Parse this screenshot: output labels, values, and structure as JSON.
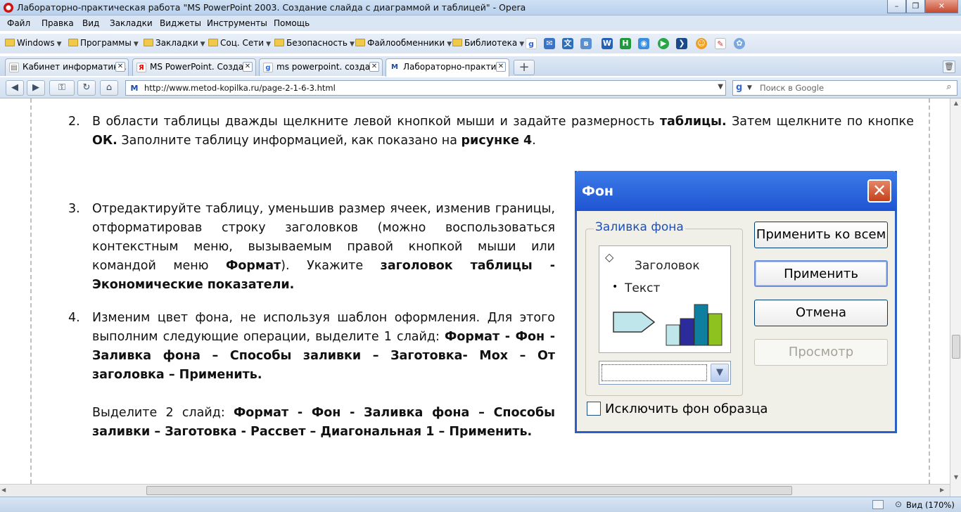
{
  "window": {
    "title": "Лабораторно-практическая работа \"MS PowerPoint 2003. Создание слайда с диаграммой и таблицей\" - Opera",
    "controls": [
      "–",
      "❐",
      "✕"
    ]
  },
  "menu": [
    "Файл",
    "Правка",
    "Вид",
    "Закладки",
    "Виджеты",
    "Инструменты",
    "Помощь"
  ],
  "bookmarks": {
    "folders": [
      "Windows",
      "Программы",
      "Закладки",
      "Соц. Сети",
      "Безопасность",
      "Файлообменники",
      "Библиотека"
    ],
    "icons": [
      "google-icon",
      "mail-icon",
      "translate-icon",
      "vk-icon",
      "word-icon",
      "h-icon",
      "web-icon",
      "play-icon",
      "arrow-icon",
      "smile-icon",
      "note-icon",
      "flower-icon"
    ]
  },
  "tabs": [
    {
      "label": "Кабинет информатик...",
      "favicon": "doc-icon"
    },
    {
      "label": "MS PowerPoint. Созда...",
      "favicon": "yandex-icon"
    },
    {
      "label": "ms powerpoint. созда...",
      "favicon": "google-icon"
    },
    {
      "label": "Лабораторно-практи...",
      "favicon": "M"
    }
  ],
  "nav": {
    "url": "http://www.metod-kopilka.ru/page-2-1-6-3.html",
    "search_placeholder": "Поиск в Google",
    "favicon": "M"
  },
  "content": {
    "item2": {
      "num": "2.",
      "text_a": "В области таблицы дважды щелкните левой кнопкой мыши и задайте размерность ",
      "bold_a": "таблицы.",
      "text_b": " Затем щелкните по кнопке ",
      "bold_b": "ОК.",
      "text_c": " Заполните таблицу информацией, как показано на ",
      "bold_c": "рисунке 4",
      "text_d": "."
    },
    "item3": {
      "num": "3.",
      "text_a": "Отредактируйте таблицу, уменьшив размер ячеек, изменив границы, отформатировав строку заголовков (можно воспользоваться контекстным меню, вызываемым правой кнопкой мыши или командой меню ",
      "bold_a": "Формат",
      "text_b": "). Укажите ",
      "bold_b": "заголовок таблицы - Экономические показатели."
    },
    "item4": {
      "num": "4.",
      "text_a": "Изменим цвет фона, не используя шаблон оформления. Для этого выполним следующие операции, выделите 1 слайд: ",
      "bold_a": "Формат - Фон - Заливка фона – Способы заливки – Заготовка- Мох – От заголовка – Применить.",
      "text_b": "Выделите 2 слайд: ",
      "bold_b": "Формат - Фон - Заливка фона – Способы заливки – Заготовка - Рассвет – Диагональная 1 – Применить."
    }
  },
  "dialog": {
    "title": "Фон",
    "group_label": "Заливка фона",
    "preview_heading": "Заголовок",
    "preview_bullet": "Текст",
    "buttons": {
      "apply_all": "Применить ко всем",
      "apply": "Применить",
      "cancel": "Отмена",
      "preview": "Просмотр"
    },
    "checkbox_label": "Исключить фон образца",
    "chart_colors": [
      "#bfe6ea",
      "#2b2b9c",
      "#0f7fa0",
      "#8ec21e"
    ],
    "chart_levels": [
      0.5,
      0.65,
      1.0,
      0.78
    ]
  },
  "status": {
    "zoom": "Вид (170%)"
  }
}
